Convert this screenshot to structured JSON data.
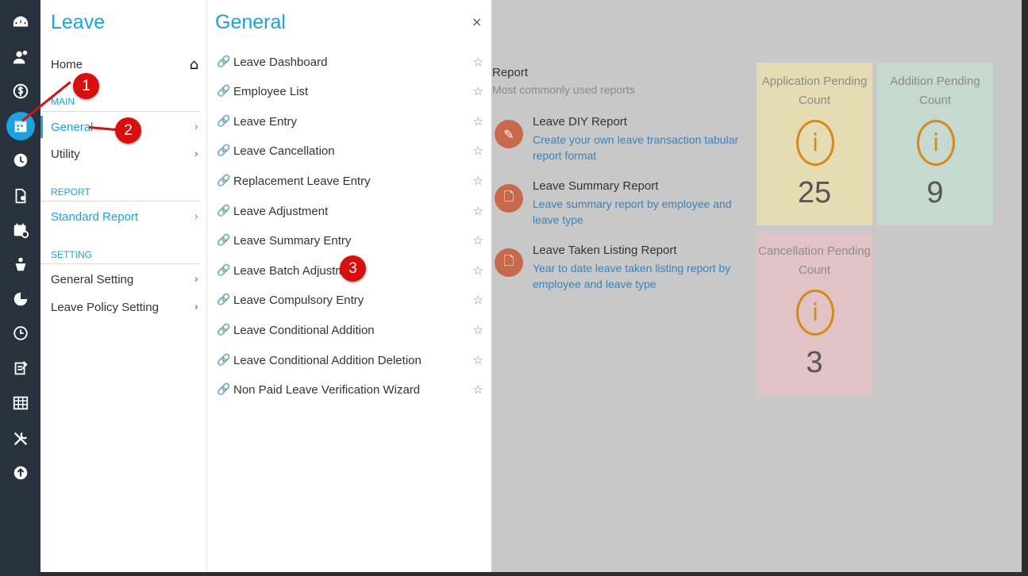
{
  "rail": {
    "icons": [
      "dashboard-icon",
      "users-icon",
      "payroll-icon",
      "leave-icon",
      "clock-icon",
      "document-icon",
      "calendar-icon",
      "medical-icon",
      "chart-icon",
      "timer-icon",
      "form-icon",
      "table-icon",
      "tools-icon",
      "upload-icon"
    ]
  },
  "nav": {
    "title": "Leave",
    "home_label": "Home",
    "main_label": "MAIN",
    "general_label": "General",
    "utility_label": "Utility",
    "report_label": "REPORT",
    "standard_report_label": "Standard Report",
    "setting_label": "SETTING",
    "general_setting_label": "General Setting",
    "leave_policy_setting_label": "Leave Policy Setting",
    "chevron": "›"
  },
  "submenu": {
    "title": "General",
    "close": "×",
    "items": [
      "Leave Dashboard",
      "Employee List",
      "Leave Entry",
      "Leave Cancellation",
      "Replacement Leave Entry",
      "Leave Adjustment",
      "Leave Summary Entry",
      "Leave Batch Adjustment",
      "Leave Compulsory Entry",
      "Leave Conditional Addition",
      "Leave Conditional Addition Deletion",
      "Non Paid Leave Verification Wizard"
    ]
  },
  "report": {
    "title": "Report",
    "subtitle": "Most commonly used reports",
    "items": [
      {
        "name": "Leave DIY Report",
        "desc": "Create your own leave transaction tabular report format",
        "icon": "pencil-icon"
      },
      {
        "name": "Leave Summary Report",
        "desc": "Leave summary report by employee and leave type",
        "icon": "file-icon"
      },
      {
        "name": "Leave Taken Listing Report",
        "desc": "Year to date leave taken listing report by employee and leave type",
        "icon": "file-icon"
      }
    ]
  },
  "cards": [
    {
      "label": "Application Pending Count",
      "value": "25",
      "color": "#e6dcb4"
    },
    {
      "label": "Addition Pending Count",
      "value": "9",
      "color": "#c5d9d1"
    },
    {
      "label": "Cancellation Pending Count",
      "value": "3",
      "color": "#e2c3c5"
    }
  ],
  "markers": [
    "1",
    "2",
    "3"
  ],
  "colors": {
    "accent": "#1aa3e0",
    "rail": "#27323d",
    "marker": "#d80f0f",
    "overlay": "#c8c8c8",
    "report_icon": "#c7694c",
    "card_icon": "#d4891a"
  }
}
